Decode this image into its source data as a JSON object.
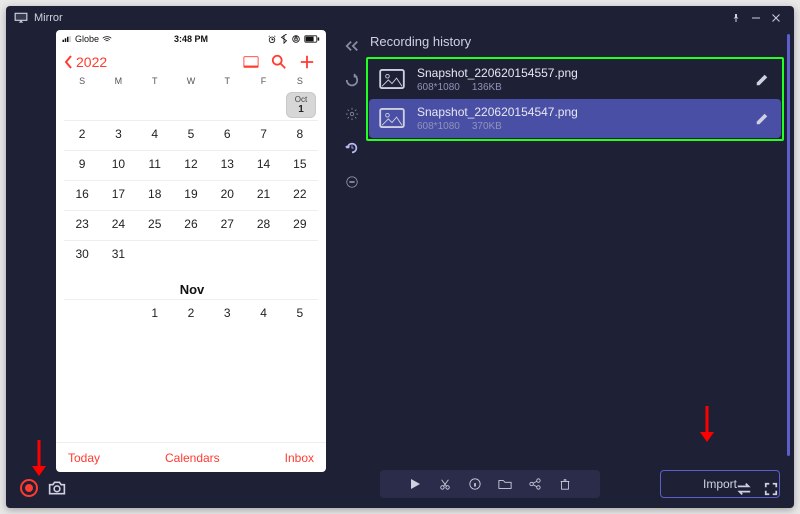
{
  "app": {
    "title": "Mirror"
  },
  "window_buttons": {
    "pin": "pin-icon",
    "min": "minimize-icon",
    "close": "close-icon"
  },
  "phone": {
    "carrier": "Globe",
    "time": "3:48 PM",
    "year": "2022",
    "weekdays": [
      "S",
      "M",
      "T",
      "W",
      "T",
      "F",
      "S"
    ],
    "oct": {
      "label": "Oct",
      "rows": [
        [
          "",
          "",
          "",
          "",
          "",
          "",
          "1"
        ],
        [
          "2",
          "3",
          "4",
          "5",
          "6",
          "7",
          "8"
        ],
        [
          "9",
          "10",
          "11",
          "12",
          "13",
          "14",
          "15"
        ],
        [
          "16",
          "17",
          "18",
          "19",
          "20",
          "21",
          "22"
        ],
        [
          "23",
          "24",
          "25",
          "26",
          "27",
          "28",
          "29"
        ],
        [
          "30",
          "31",
          "",
          "",
          "",
          "",
          ""
        ]
      ],
      "today_day": "1"
    },
    "nov": {
      "label": "Nov",
      "rows": [
        [
          "",
          "",
          "1",
          "2",
          "3",
          "4",
          "5"
        ]
      ]
    },
    "footer": {
      "today": "Today",
      "calendars": "Calendars",
      "inbox": "Inbox"
    }
  },
  "sidepanel_icons": [
    "collapse",
    "refresh",
    "settings",
    "history",
    "minus"
  ],
  "recording": {
    "title": "Recording history",
    "items": [
      {
        "name": "Snapshot_220620154557.png",
        "dims": "608*1080",
        "size": "136KB",
        "selected": false
      },
      {
        "name": "Snapshot_220620154547.png",
        "dims": "608*1080",
        "size": "370KB",
        "selected": true
      }
    ],
    "import": "Import"
  },
  "action_bar": [
    "play",
    "cut",
    "info",
    "folder",
    "share",
    "delete"
  ]
}
